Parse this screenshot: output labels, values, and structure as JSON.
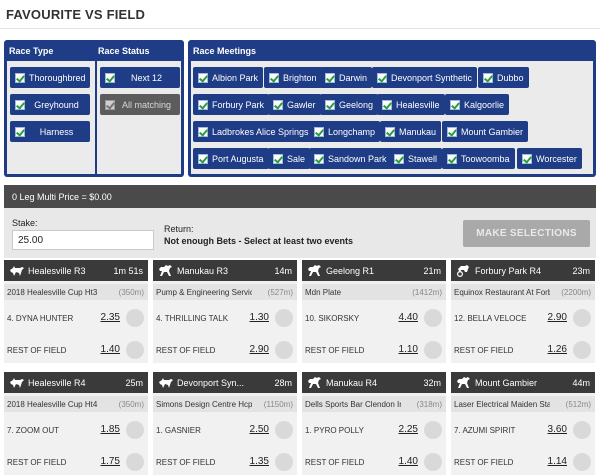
{
  "page": {
    "title": "FAVOURITE VS FIELD"
  },
  "race_type": {
    "heading": "Race Type",
    "items": [
      "Thoroughbred",
      "Greyhound",
      "Harness"
    ]
  },
  "race_status": {
    "heading": "Race Status",
    "items": [
      {
        "label": "Next 12",
        "enabled": true
      },
      {
        "label": "All matching",
        "enabled": false
      }
    ]
  },
  "race_meetings": {
    "heading": "Race Meetings",
    "items": [
      "Albion Park",
      "Brighton",
      "Darwin",
      "Devonport Synthetic",
      "Dubbo",
      "Forbury Park",
      "Gawler",
      "Geelong",
      "Healesville",
      "Kalgoorlie",
      "Ladbrokes Alice Springs",
      "Longchamp",
      "Manukau",
      "Mount Gambier",
      "Port Augusta",
      "Sale",
      "Sandown Park",
      "Stawell",
      "Toowoomba",
      "Worcester"
    ]
  },
  "multi": {
    "price_text": "0 Leg Multi Price = $0.00"
  },
  "stake": {
    "label": "Stake:",
    "value": "25.00",
    "return_label": "Return:",
    "return_message": "Not enough Bets - Select at least two events",
    "button_label": "MAKE SELECTIONS"
  },
  "races": [
    {
      "icon": "greyhound-icon",
      "meeting": "Healesville R3",
      "time": "1m 51s",
      "race_name": "2018 Healesville Cup Ht3",
      "distance": "(350m)",
      "favourite": "4. DYNA HUNTER",
      "fav_price": "2.35",
      "field_label": "REST OF FIELD",
      "field_price": "1.40"
    },
    {
      "icon": "horse-icon",
      "meeting": "Manukau R3",
      "time": "14m",
      "race_name": "Pump & Engineering Service",
      "distance": "(527m)",
      "favourite": "4. THRILLING TALK",
      "fav_price": "1.30",
      "field_label": "REST OF FIELD",
      "field_price": "2.90"
    },
    {
      "icon": "horse-icon",
      "meeting": "Geelong R1",
      "time": "21m",
      "race_name": "Mdn Plate",
      "distance": "(1412m)",
      "favourite": "10. SIKORSKY",
      "fav_price": "4.40",
      "field_label": "REST OF FIELD",
      "field_price": "1.10"
    },
    {
      "icon": "harness-icon",
      "meeting": "Forbury Park R4",
      "time": "23m",
      "race_name": "Equinox Restaurant At Forbury",
      "distance": "(2200m)",
      "favourite": "12. BELLA VELOCE",
      "fav_price": "2.90",
      "field_label": "REST OF FIELD",
      "field_price": "1.26"
    },
    {
      "icon": "greyhound-icon",
      "meeting": "Healesville R4",
      "time": "25m",
      "race_name": "2018 Healesville Cup Ht4",
      "distance": "(350m)",
      "favourite": "7. ZOOM OUT",
      "fav_price": "1.85",
      "field_label": "REST OF FIELD",
      "field_price": "1.75"
    },
    {
      "icon": "greyhound-icon",
      "meeting": "Devonport Syn...",
      "time": "28m",
      "race_name": "Simons Design Centre Hcp (",
      "distance": "(1150m)",
      "favourite": "1. GASNIER",
      "fav_price": "2.50",
      "field_label": "REST OF FIELD",
      "field_price": "1.35"
    },
    {
      "icon": "horse-icon",
      "meeting": "Manukau R4",
      "time": "32m",
      "race_name": "Dells Sports Bar Clendon Ir",
      "distance": "(318m)",
      "favourite": "1. PYRO POLLY",
      "fav_price": "2.25",
      "field_label": "REST OF FIELD",
      "field_price": "1.40"
    },
    {
      "icon": "horse-icon",
      "meeting": "Mount Gambier",
      "time": "44m",
      "race_name": "Laser Electrical Maiden Stake",
      "distance": "(512m)",
      "favourite": "7. AZUMI SPIRIT",
      "fav_price": "3.60",
      "field_label": "REST OF FIELD",
      "field_price": "1.14"
    }
  ]
}
